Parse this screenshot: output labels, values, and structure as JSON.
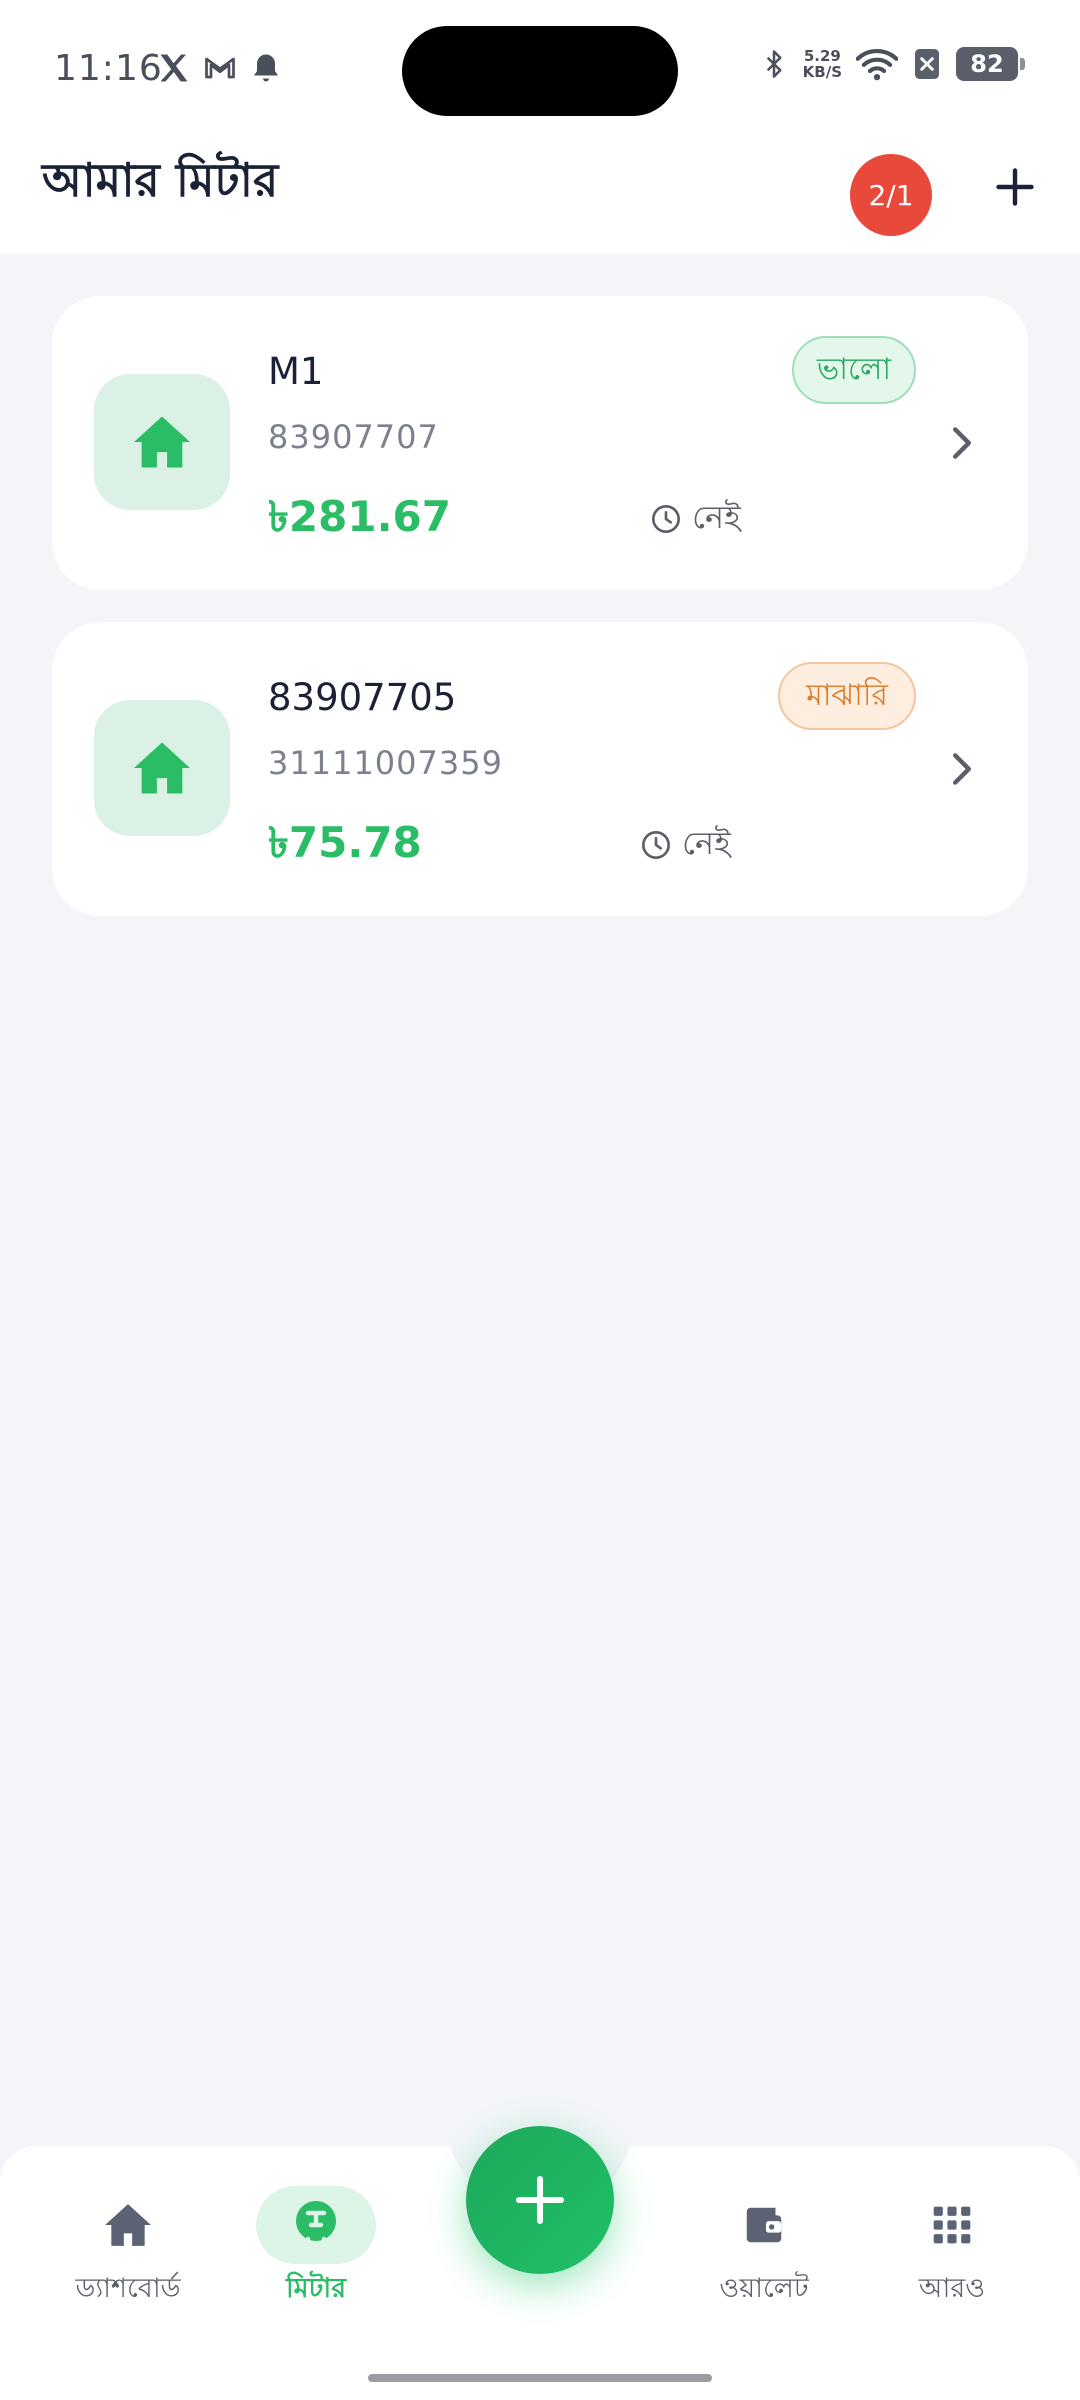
{
  "status_bar": {
    "time": "11:16",
    "net_speed_value": "5.29",
    "net_speed_unit": "KB/S",
    "battery": "82",
    "icons": [
      "x-logo-icon",
      "gmail-icon",
      "bell-icon",
      "bluetooth-icon",
      "wifi-icon",
      "no-sim-icon",
      "battery-icon"
    ]
  },
  "header": {
    "title": "আমার মিটার",
    "count_badge": "2/1",
    "add_icon": "plus-icon"
  },
  "meters": [
    {
      "name": "M1",
      "number": "83907707",
      "balance": "৳281.67",
      "status": "ভালো",
      "status_type": "good",
      "last_update": "নেই"
    },
    {
      "name": "83907705",
      "number": "31111007359",
      "balance": "৳75.78",
      "status": "মাঝারি",
      "status_type": "medium",
      "last_update": "নেই"
    }
  ],
  "bottom_nav": {
    "items": [
      {
        "label": "ড্যাশবোর্ড",
        "icon": "home-icon",
        "active": false
      },
      {
        "label": "মিটার",
        "icon": "meter-icon",
        "active": true
      },
      {
        "label": "ওয়ালেট",
        "icon": "wallet-icon",
        "active": false
      },
      {
        "label": "আরও",
        "icon": "grid-icon",
        "active": false
      }
    ],
    "fab_icon": "plus-icon"
  },
  "colors": {
    "accent_green": "#2bbd66",
    "badge_red": "#e8493b",
    "good_text": "#27a85d",
    "medium_text": "#dd7a2a",
    "background": "#f3f5f9"
  }
}
